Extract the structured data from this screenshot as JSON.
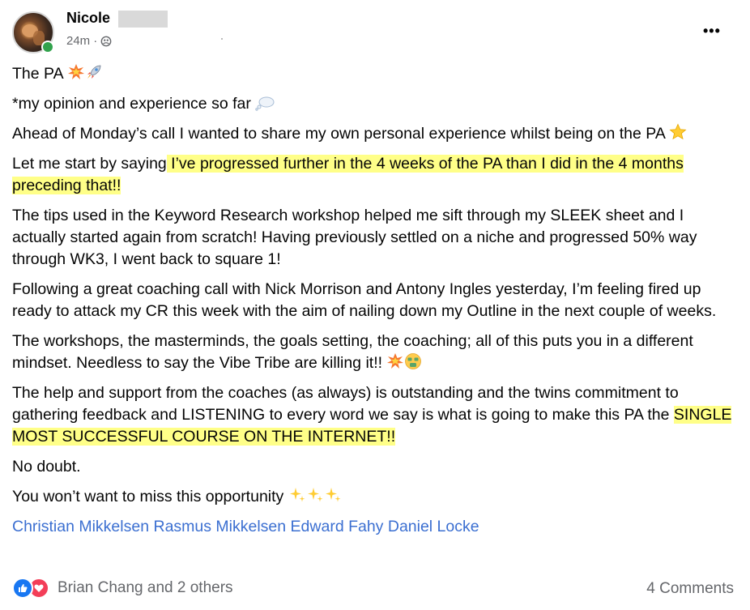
{
  "post": {
    "author_name": "Nicole",
    "time": "24m",
    "separator": "·",
    "privacy_icon": "group-privacy-icon",
    "more_label": "•••",
    "paragraphs": {
      "p1": "The PA",
      "p2": "*my opinion and experience so far",
      "p3": "Ahead of Monday’s call I wanted to share my own personal experience whilst being on the PA",
      "p4a": "Let me start by saying",
      "p4b": " I’ve progressed further in the 4 weeks of the PA than I did in the 4 months preceding that!!",
      "p5": "The tips used in the Keyword Research workshop helped me sift through my SLEEK sheet and I actually started again from scratch! Having previously settled on a niche and progressed 50% way through WK3, I went back to square 1!",
      "p6": "Following a great coaching call with Nick Morrison and Antony Ingles yesterday, I’m feeling fired up ready to attack my CR this week with the aim of nailing down my Outline in the next couple of weeks.",
      "p7": "The workshops, the masterminds, the goals setting, the coaching; all of this puts you in a different mindset. Needless to say the Vibe Tribe are killing it!!",
      "p8a": "The help and support from the coaches (as always) is outstanding and the twins commitment to gathering feedback and LISTENING to every word we say is what is going to make this PA the",
      "p8b": "SINGLE MOST SUCCESSFUL COURSE ON THE INTERNET!!",
      "p9": "No doubt.",
      "p10": "You won’t want to miss this opportunity"
    },
    "emojis": {
      "p1": [
        "collision-icon",
        "rocket-icon"
      ],
      "p2": [
        "thought-balloon-icon"
      ],
      "p3": [
        "star-icon"
      ],
      "p7": [
        "collision-icon",
        "money-mouth-face-icon"
      ],
      "p10": [
        "sparkles-icon",
        "sparkles-icon",
        "sparkles-icon"
      ]
    },
    "tags": [
      "Christian Mikkelsen",
      "Rasmus Mikkelsen",
      "Edward Fahy",
      "Daniel Locke"
    ],
    "highlight_color": "#ffff88",
    "tag_color": "#3b6fd1"
  },
  "footer": {
    "reaction_icons": [
      "like-icon",
      "love-icon"
    ],
    "reactors": "Brian Chang and 2 others",
    "comments": "4 Comments"
  }
}
